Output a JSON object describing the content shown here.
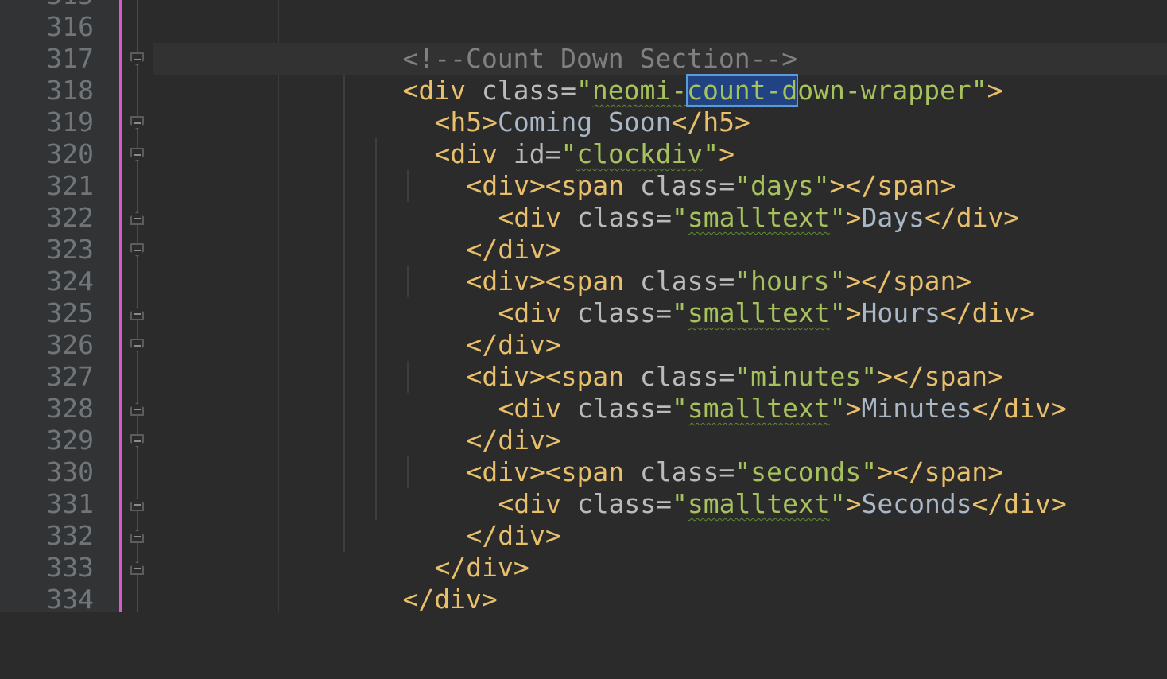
{
  "editor": {
    "language": "HTML",
    "selected_text": "count-d",
    "colors": {
      "background": "#2b2b2b",
      "gutter": "#313335",
      "tag": "#e8bf6a",
      "attribute": "#bababa",
      "value": "#a5c25c",
      "text": "#a9b7c6",
      "comment": "#808080",
      "selection": "#214283",
      "right_margin_marker": "#d65bd1"
    },
    "line_numbers": [
      "316",
      "317",
      "318",
      "319",
      "320",
      "321",
      "322",
      "323",
      "324",
      "325",
      "326",
      "327",
      "328",
      "329",
      "330",
      "331",
      "332",
      "333",
      "334"
    ],
    "top_partial_line": "315",
    "fold_markers": [
      "none",
      "open",
      "none",
      "open",
      "open",
      "none",
      "close",
      "open",
      "none",
      "close",
      "open",
      "none",
      "close",
      "open",
      "none",
      "close",
      "close",
      "close",
      "none"
    ],
    "code": {
      "l316": "<!--Count Down Section-->",
      "l317_open": "<div ",
      "l317_attr": "class=",
      "l317_q1": "\"",
      "l317_v1": "neomi-",
      "l317_sel": "count-d",
      "l317_v2": "own-wrapper",
      "l317_q2": "\"",
      "l317_close": ">",
      "l318_tag1": "<h5>",
      "l318_text": "Coming Soon",
      "l318_tag2": "</h5>",
      "l319_open": "<div ",
      "l319_attr": "id=",
      "l319_q1": "\"",
      "l319_val": "clockdiv",
      "l319_q2": "\"",
      "l319_close": ">",
      "l320_open": "<div><span ",
      "l320_attr": "class=",
      "l320_val": "\"days\"",
      "l320_close": "></span>",
      "l321_open": "<div ",
      "l321_attr": "class=",
      "l321_q1": "\"",
      "l321_val": "smalltext",
      "l321_q2": "\"",
      "l321_gt": ">",
      "l321_text": "Days",
      "l321_end": "</div>",
      "l322": "</div>",
      "l323_open": "<div><span ",
      "l323_attr": "class=",
      "l323_val": "\"hours\"",
      "l323_close": "></span>",
      "l324_open": "<div ",
      "l324_attr": "class=",
      "l324_q1": "\"",
      "l324_val": "smalltext",
      "l324_q2": "\"",
      "l324_gt": ">",
      "l324_text": "Hours",
      "l324_end": "</div>",
      "l325": "</div>",
      "l326_open": "<div><span ",
      "l326_attr": "class=",
      "l326_val": "\"minutes\"",
      "l326_close": "></span>",
      "l327_open": "<div ",
      "l327_attr": "class=",
      "l327_q1": "\"",
      "l327_val": "smalltext",
      "l327_q2": "\"",
      "l327_gt": ">",
      "l327_text": "Minutes",
      "l327_end": "</div>",
      "l328": "</div>",
      "l329_open": "<div><span ",
      "l329_attr": "class=",
      "l329_val": "\"seconds\"",
      "l329_close": "></span>",
      "l330_open": "<div ",
      "l330_attr": "class=",
      "l330_q1": "\"",
      "l330_val": "smalltext",
      "l330_q2": "\"",
      "l330_gt": ">",
      "l330_text": "Seconds",
      "l330_end": "</div>",
      "l331": "</div>",
      "l332": "</div>",
      "l333": "</div>",
      "l334": ""
    }
  }
}
